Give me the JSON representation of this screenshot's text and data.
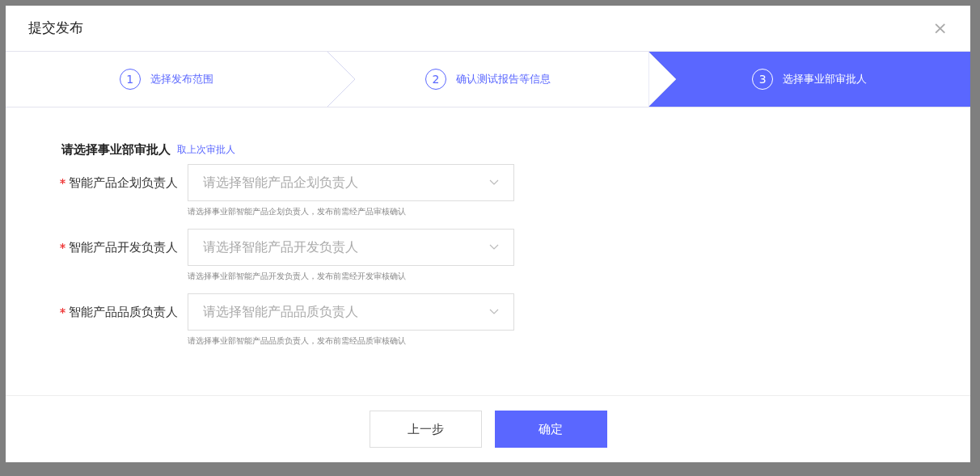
{
  "dialog": {
    "title": "提交发布",
    "close": "×"
  },
  "steps": [
    {
      "number": "1",
      "label": "选择发布范围",
      "selected": false
    },
    {
      "number": "2",
      "label": "确认测试报告等信息",
      "selected": false
    },
    {
      "number": "3",
      "label": "选择事业部审批人",
      "selected": true
    }
  ],
  "form": {
    "heading": "请选择事业部审批人",
    "link": "取上次审批人",
    "fields": [
      {
        "required": true,
        "label": "智能产品企划负责人",
        "placeholder": "请选择智能产品企划负责人",
        "hint": "请选择事业部智能产品企划负责人，发布前需经产品审核确认"
      },
      {
        "required": true,
        "label": "智能产品开发负责人",
        "placeholder": "请选择智能产品开发负责人",
        "hint": "请选择事业部智能产品开发负责人，发布前需经开发审核确认"
      },
      {
        "required": true,
        "label": "智能产品品质负责人",
        "placeholder": "请选择智能产品品质负责人",
        "hint": "请选择事业部智能产品品质负责人，发布前需经品质审核确认"
      }
    ]
  },
  "buttons": [
    {
      "label": "上一步",
      "kind": "secondary"
    },
    {
      "label": "确定",
      "kind": "primary"
    }
  ]
}
